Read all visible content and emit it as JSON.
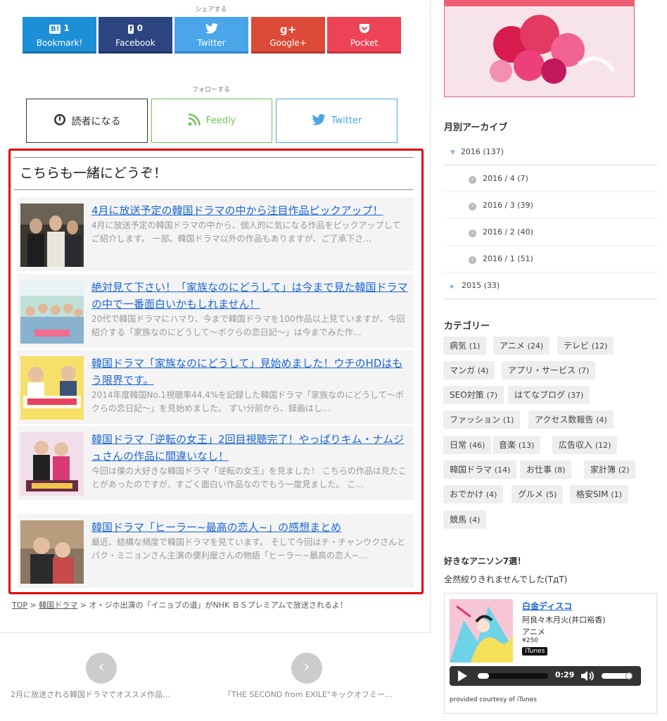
{
  "share": {
    "caption": "シェアする",
    "buttons": [
      {
        "icon": "B!",
        "count": "1",
        "label": "Bookmark!",
        "color": "#1d8fd6"
      },
      {
        "icon": "f",
        "count": "0",
        "label": "Facebook",
        "color": "#2c4582"
      },
      {
        "icon": "🐦",
        "count": "",
        "label": "Twitter",
        "color": "#4aa6e8"
      },
      {
        "icon": "g+",
        "count": "",
        "label": "Google+",
        "color": "#dc4a38"
      },
      {
        "icon": "◙",
        "count": "",
        "label": "Pocket",
        "color": "#ee4256"
      }
    ]
  },
  "follow": {
    "caption": "フォローする",
    "reader_label": "読者になる",
    "feedly_label": "Feedly",
    "twitter_label": "Twitter"
  },
  "related": {
    "title": "こちらも一緒にどうぞ！",
    "items": [
      {
        "title": "4月に放送予定の韓国ドラマの中から注目作品ピックアップ！",
        "desc": "4月に放送予定の韓国ドラマの中から、個人的に気になる作品をピックアップしてご紹介します。 一部、韓国ドラマ以外の作品もありますが、ご了承下さ…"
      },
      {
        "title": "絶対見て下さい！「家族なのにどうして」は今まで見た韓国ドラマの中で一番面白いかもしれません！",
        "desc": "20代で韓国ドラマにハマり、今まで韓国ドラマを100作品以上見ていますが、今回紹介する「家族なのにどうして〜ボクらの恋日記〜」は今までみた作…"
      },
      {
        "title": "韓国ドラマ「家族なのにどうして」見始めました！ウチのHDはもう限界です。",
        "desc": "2014年度韓国No.1視聴率44.4%を記録した韓国ドラマ「家族なのにどうして〜ボクらの恋日記〜」を見始めました。 ずい分前から、録画はし…"
      },
      {
        "title": "韓国ドラマ「逆転の女王」2回目視聴完了！やっぱりキム・ナムジュさんの作品に間違いなし！",
        "desc": "今回は僕の大好きな韓国ドラマ「逆転の女王」を見ました！ こちらの作品は見たことがあったのですが、すごく面白い作品なのでもう一度見ました。 こ…"
      },
      {
        "title": "韓国ドラマ「ヒーラー~最高の恋人~」の感想まとめ",
        "desc": "最近、結構な頻度で韓国ドラマを見ています。 そして今回はチ・チャンウクさんとパク・ミニョンさん主演の便利屋さんの物語「ヒーラー~最高の恋人~…"
      }
    ]
  },
  "breadcrumb": {
    "top": "TOP",
    "sep": " > ",
    "category": "韓国ドラマ",
    "current": "オ・ジホ出演の「イニョブの道」がNHK ＢＳプレミアムで放送されるよ！"
  },
  "pager": {
    "prev_icon": "‹",
    "next_icon": "›",
    "prev_title": "2月に放送される韓国ドラマでオススメ作品…",
    "next_title": "「THE SECOND from EXILE\"キックオフミー…"
  },
  "sidebar": {
    "archive_heading": "月別アーカイブ",
    "archive": [
      {
        "label": "2016 (137)",
        "marker": "▼"
      },
      {
        "label": "2016 / 4 (7)",
        "marker": "›"
      },
      {
        "label": "2016 / 3 (39)",
        "marker": "›"
      },
      {
        "label": "2016 / 2 (40)",
        "marker": "›"
      },
      {
        "label": "2016 / 1 (51)",
        "marker": "›"
      },
      {
        "label": "2015 (33)",
        "marker": "▶"
      }
    ],
    "category_heading": "カテゴリー",
    "categories": [
      {
        "name": "病気",
        "count": "(1)"
      },
      {
        "name": "アニメ",
        "count": "(24)"
      },
      {
        "name": "テレビ",
        "count": "(12)"
      },
      {
        "name": "マンガ",
        "count": "(4)"
      },
      {
        "name": "アプリ・サービス",
        "count": "(7)"
      },
      {
        "name": "SEO対策",
        "count": "(7)"
      },
      {
        "name": "はてなブログ",
        "count": "(37)"
      },
      {
        "name": "ファッション",
        "count": "(1)"
      },
      {
        "name": "アクセス数報告",
        "count": "(4)"
      },
      {
        "name": "日常",
        "count": "(46)"
      },
      {
        "name": "音楽",
        "count": "(13)"
      },
      {
        "name": "広告収入",
        "count": "(12)"
      },
      {
        "name": "韓国ドラマ",
        "count": "(14)"
      },
      {
        "name": "お仕事",
        "count": "(8)"
      },
      {
        "name": "家計簿",
        "count": "(2)"
      },
      {
        "name": "おでかけ",
        "count": "(4)"
      },
      {
        "name": "グルメ",
        "count": "(5)"
      },
      {
        "name": "格安SIM",
        "count": "(1)"
      },
      {
        "name": "競馬",
        "count": "(4)"
      }
    ],
    "anison_heading": "好きなアニソン7選！",
    "anison_sub": "全然絞りきれませんでした(TдT)",
    "itunes": {
      "song": "白金ディスコ",
      "artist": "阿良々木月火(井口裕香)",
      "genre": "アニメ",
      "price": "¥250",
      "badge": "iTunes",
      "time": "0:29",
      "credit": "provided courtesy of iTunes"
    }
  }
}
